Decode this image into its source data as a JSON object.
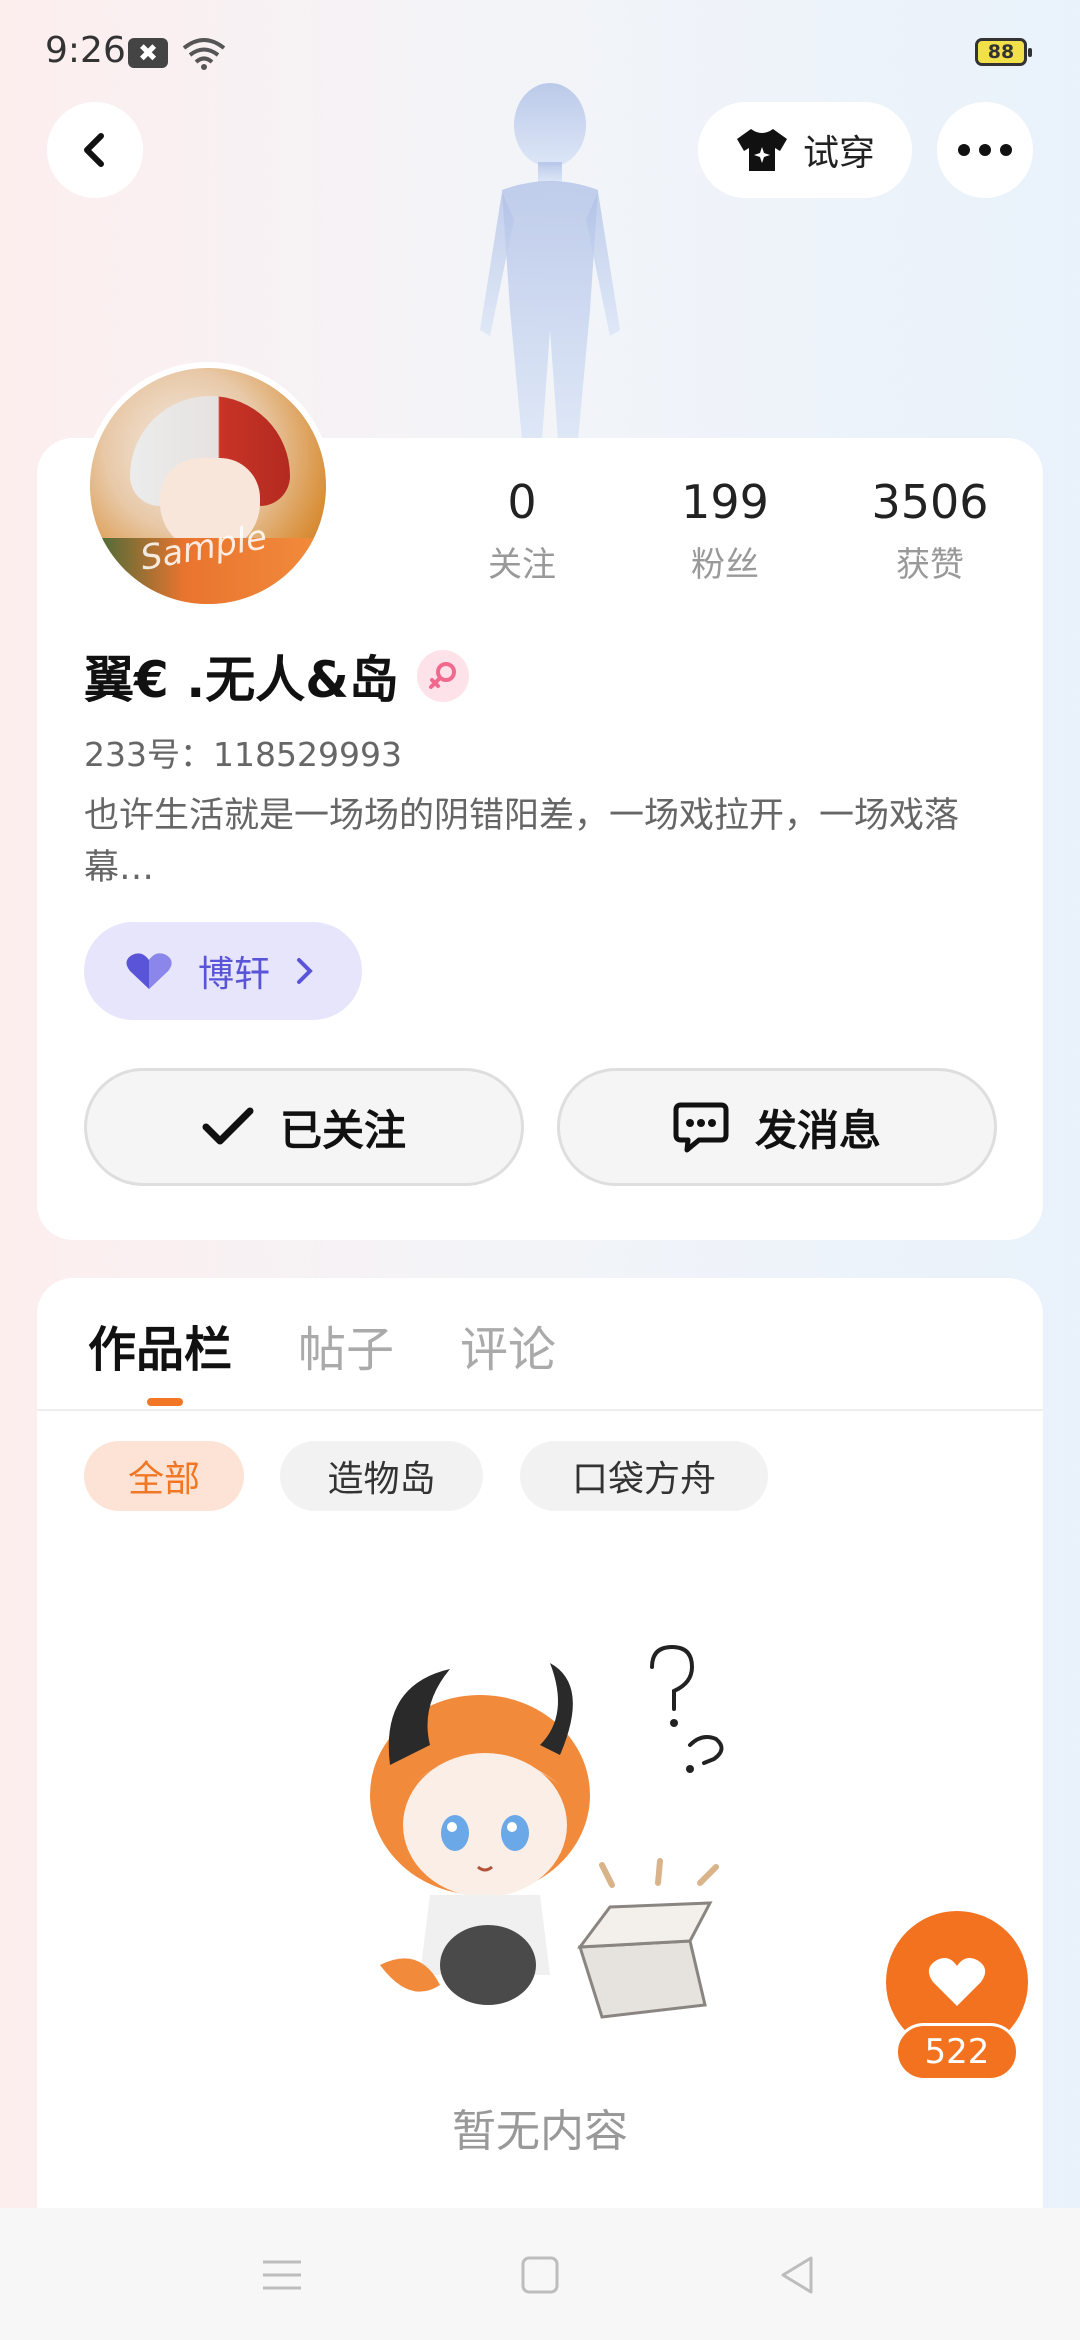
{
  "status_bar": {
    "time": "9:26",
    "battery": "88"
  },
  "header": {
    "try_on_label": "试穿"
  },
  "profile": {
    "stats": [
      {
        "value": "0",
        "label": "关注"
      },
      {
        "value": "199",
        "label": "粉丝"
      },
      {
        "value": "3506",
        "label": "获赞"
      }
    ],
    "username": "翼€ .无人&岛",
    "uid": "233号：118529993",
    "bio": "也许生活就是一场场的阴错阳差，一场戏拉开，一场戏落幕…",
    "avatar_watermark": "Sample",
    "tag_label": "博轩",
    "follow_label": "已关注",
    "message_label": "发消息"
  },
  "tabs": [
    {
      "label": "作品栏"
    },
    {
      "label": "帖子"
    },
    {
      "label": "评论"
    }
  ],
  "filters": [
    {
      "label": "全部"
    },
    {
      "label": "造物岛"
    },
    {
      "label": "口袋方舟"
    }
  ],
  "empty_state": {
    "text": "暂无内容"
  },
  "like": {
    "count": "522"
  },
  "colors": {
    "accent": "#f3721f",
    "tag_purple": "#5a55d8"
  }
}
